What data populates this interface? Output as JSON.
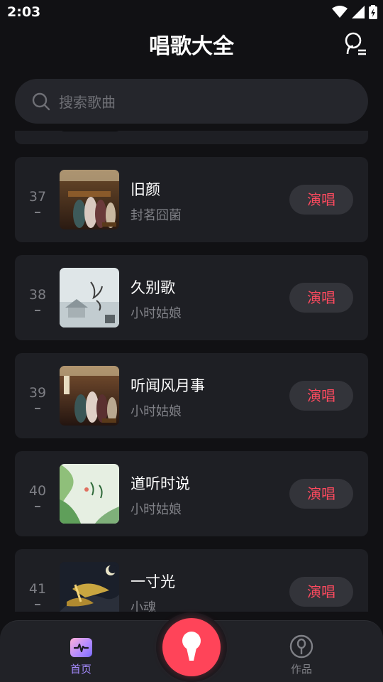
{
  "status_bar": {
    "time": "2:03"
  },
  "header": {
    "title": "唱歌大全"
  },
  "search": {
    "placeholder": "搜索歌曲"
  },
  "songs": [
    {
      "rank": "37",
      "title": "旧颜",
      "artist": "封茗囧菌",
      "action": "演唱"
    },
    {
      "rank": "38",
      "title": "久别歌",
      "artist": "小时姑娘",
      "action": "演唱"
    },
    {
      "rank": "39",
      "title": "听闻风月事",
      "artist": "小时姑娘",
      "action": "演唱"
    },
    {
      "rank": "40",
      "title": "道听时说",
      "artist": "小时姑娘",
      "action": "演唱"
    },
    {
      "rank": "41",
      "title": "一寸光",
      "artist": "小魂",
      "action": "演唱"
    }
  ],
  "bottom_nav": {
    "home_label": "首页",
    "works_label": "作品"
  },
  "colors": {
    "accent": "#ff4459",
    "nav_active": "#a58bff",
    "background": "#111114",
    "card": "#1e1f24"
  }
}
